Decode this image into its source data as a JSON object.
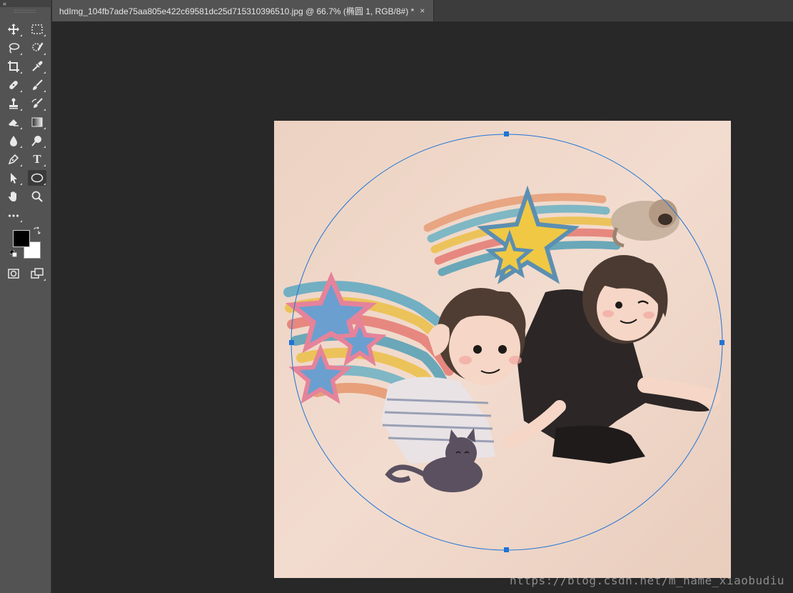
{
  "toolbar": {
    "collapse_glyph": "«",
    "tools": [
      {
        "name": "move-tool",
        "icon": "move-icon"
      },
      {
        "name": "marquee-tool",
        "icon": "rect-marquee-icon"
      },
      {
        "name": "lasso-tool",
        "icon": "lasso-icon"
      },
      {
        "name": "quick-select-tool",
        "icon": "quick-select-icon"
      },
      {
        "name": "crop-tool",
        "icon": "crop-icon"
      },
      {
        "name": "eyedropper-tool",
        "icon": "eyedropper-icon"
      },
      {
        "name": "healing-tool",
        "icon": "bandage-icon"
      },
      {
        "name": "brush-tool",
        "icon": "brush-icon"
      },
      {
        "name": "stamp-tool",
        "icon": "stamp-icon"
      },
      {
        "name": "history-brush-tool",
        "icon": "history-brush-icon"
      },
      {
        "name": "eraser-tool",
        "icon": "eraser-icon"
      },
      {
        "name": "gradient-tool",
        "icon": "gradient-icon"
      },
      {
        "name": "blur-tool",
        "icon": "drop-icon"
      },
      {
        "name": "dodge-tool",
        "icon": "dodge-icon"
      },
      {
        "name": "pen-tool",
        "icon": "pen-icon"
      },
      {
        "name": "type-tool",
        "icon": "type-icon",
        "label": "T"
      },
      {
        "name": "path-select-tool",
        "icon": "arrow-icon"
      },
      {
        "name": "ellipse-tool",
        "icon": "ellipse-icon",
        "active": true
      },
      {
        "name": "hand-tool",
        "icon": "hand-icon"
      },
      {
        "name": "zoom-tool",
        "icon": "magnifier-icon"
      },
      {
        "name": "more-tools",
        "icon": "ellipsis-icon"
      }
    ],
    "foreground_color": "#000000",
    "background_color": "#ffffff"
  },
  "document": {
    "tab_title": "hdImg_104fb7ade75aa805e422c69581dc25d715310396510.jpg @ 66.7% (椭圆 1, RGB/8#) *",
    "close_glyph": "×"
  },
  "colors": {
    "workspace": "#282828",
    "panel": "#535353",
    "selection": "#1e74d6",
    "paper": "#f0d6c8"
  },
  "watermark": "https://blog.csdn.net/m_name_xiaobudiu"
}
